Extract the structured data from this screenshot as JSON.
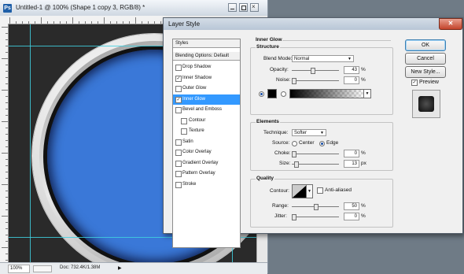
{
  "document": {
    "title": "Untitled-1 @ 100% (Shape 1 copy 3, RGB/8) *",
    "app_icon": "Ps",
    "zoom": "100%",
    "doc_size": "Doc: 732.4K/1.38M"
  },
  "dialog": {
    "title": "Layer Style",
    "close_symbol": "✕",
    "styles_list": {
      "header": "Styles",
      "blending": "Blending Options: Default",
      "items": [
        {
          "label": "Drop Shadow",
          "checked": false
        },
        {
          "label": "Inner Shadow",
          "checked": true
        },
        {
          "label": "Outer Glow",
          "checked": false
        },
        {
          "label": "Inner Glow",
          "checked": true,
          "selected": true
        },
        {
          "label": "Bevel and Emboss",
          "checked": false
        },
        {
          "label": "Contour",
          "checked": false,
          "indented": true
        },
        {
          "label": "Texture",
          "checked": false,
          "indented": true
        },
        {
          "label": "Satin",
          "checked": false
        },
        {
          "label": "Color Overlay",
          "checked": false
        },
        {
          "label": "Gradient Overlay",
          "checked": false
        },
        {
          "label": "Pattern Overlay",
          "checked": false
        },
        {
          "label": "Stroke",
          "checked": false
        }
      ]
    },
    "panel_title": "Inner Glow",
    "structure": {
      "title": "Structure",
      "blend_mode_label": "Blend Mode:",
      "blend_mode_value": "Normal",
      "opacity_label": "Opacity:",
      "opacity_value": "43",
      "opacity_unit": "%",
      "opacity_fraction": 0.43,
      "noise_label": "Noise:",
      "noise_value": "0",
      "noise_unit": "%",
      "noise_fraction": 0.0,
      "glow_color": "#000000"
    },
    "elements": {
      "title": "Elements",
      "technique_label": "Technique:",
      "technique_value": "Softer",
      "source_label": "Source:",
      "source_center": "Center",
      "source_edge": "Edge",
      "source_selected": "Edge",
      "choke_label": "Choke:",
      "choke_value": "0",
      "choke_unit": "%",
      "choke_fraction": 0.0,
      "size_label": "Size:",
      "size_value": "13",
      "size_unit": "px",
      "size_fraction": 0.05
    },
    "quality": {
      "title": "Quality",
      "contour_label": "Contour:",
      "anti_aliased_label": "Anti-aliased",
      "anti_aliased_checked": false,
      "range_label": "Range:",
      "range_value": "50",
      "range_unit": "%",
      "range_fraction": 0.5,
      "jitter_label": "Jitter:",
      "jitter_value": "0",
      "jitter_unit": "%",
      "jitter_fraction": 0.0
    },
    "buttons": {
      "ok": "OK",
      "cancel": "Cancel",
      "new_style": "New Style...",
      "preview_label": "Preview",
      "preview_checked": true
    }
  },
  "colors": {
    "button_fill": "#3a78d8",
    "selection": "#3399ff",
    "guide": "#3fd0e0"
  }
}
